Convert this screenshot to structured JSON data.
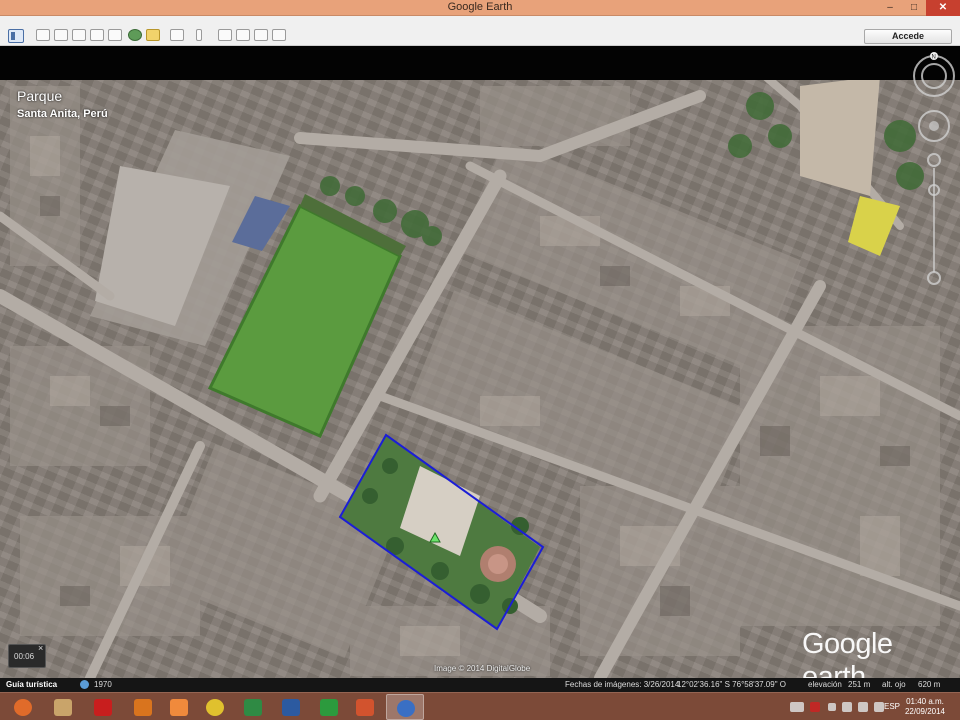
{
  "window": {
    "title": "Google Earth",
    "controls": [
      "–",
      "□",
      "✕"
    ]
  },
  "toolbar": {
    "signin_label": "Accede",
    "icons": [
      "sidebar-toggle-icon",
      "add-placemark-icon",
      "add-polygon-icon",
      "add-path-icon",
      "add-overlay-icon",
      "record-tour-icon",
      "historical-imagery-icon",
      "sunlight-icon",
      "switch-to-sky-icon",
      "ruler-icon",
      "email-icon",
      "print-icon",
      "save-image-icon",
      "view-in-maps-icon"
    ]
  },
  "place": {
    "name": "Parque",
    "location": "Santa Anita, Perú"
  },
  "tour": {
    "time": "00:06",
    "close": "×"
  },
  "logo": {
    "main": "Google",
    "secondary": " earth"
  },
  "credit": "Image © 2014 DigitalGlobe",
  "statusbar": {
    "guide": "Guía turística",
    "year": "1970",
    "imagery_date": "Fechas de imágenes: 3/26/2014",
    "coords": "12°02'36.16\" S  76°58'37.09\" O",
    "elevation_label": "elevación",
    "elevation": "251 m",
    "eye_alt_label": "alt. ojo",
    "eye_alt": "620 m"
  },
  "taskbar": {
    "apps": [
      "firefox",
      "file-explorer",
      "adobe-reader",
      "app-f",
      "audio-app",
      "chrome",
      "excel",
      "word",
      "store",
      "powerpoint",
      "google-earth"
    ],
    "active_app": "google-earth",
    "language": "ESP",
    "time": "01:40 a.m.",
    "date": "22/09/2014"
  },
  "colors": {
    "titlebar": "#e8a27a",
    "taskbar": "#7c4a38",
    "polygon": "#1b1ed6",
    "field": "#5b9b3f"
  }
}
